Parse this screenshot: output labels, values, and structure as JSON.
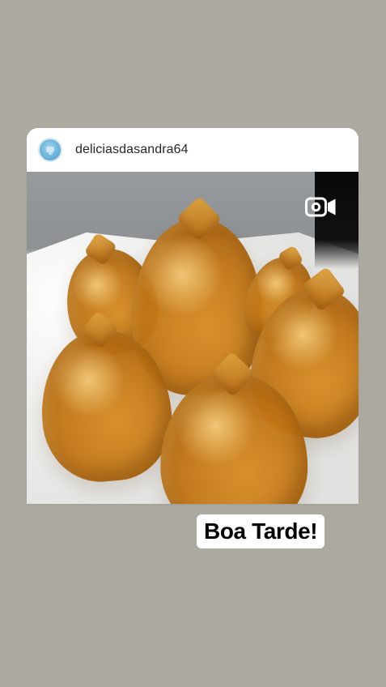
{
  "post": {
    "username": "deliciasdasandra64",
    "avatar_icon": "profile-avatar-icon",
    "media_icon": "video-camera-icon"
  },
  "overlay": {
    "text": "Boa Tarde!"
  },
  "colors": {
    "background": "#acaaa0",
    "card": "#ffffff",
    "text": "#262626",
    "accent_avatar": "#6cb4da"
  }
}
